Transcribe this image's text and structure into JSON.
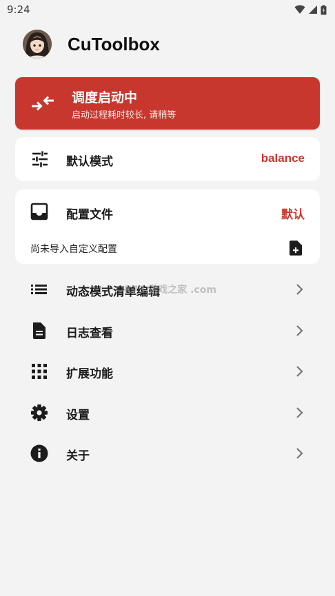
{
  "status_bar": {
    "time": "9:24"
  },
  "app": {
    "title": "CuToolbox"
  },
  "status_card": {
    "title": "调度启动中",
    "subtitle": "启动过程耗时较长, 请稍等",
    "icon": "swap-arrows-icon",
    "color": "#c8372d"
  },
  "mode_card": {
    "label": "默认模式",
    "value": "balance",
    "icon": "tune-icon"
  },
  "config_card": {
    "label": "配置文件",
    "value": "默认",
    "note": "尚未导入自定义配置",
    "icon": "inbox-icon",
    "action_icon": "add-file-icon"
  },
  "menu": [
    {
      "label": "动态模式清单编辑",
      "icon": "list-icon"
    },
    {
      "label": "日志查看",
      "icon": "document-icon"
    },
    {
      "label": "扩展功能",
      "icon": "grid-icon"
    },
    {
      "label": "设置",
      "icon": "gear-icon"
    },
    {
      "label": "关于",
      "icon": "info-icon"
    }
  ],
  "watermark": "K73 游戏之家 .com",
  "colors": {
    "accent": "#c8372d",
    "background": "#f3f3f3",
    "card": "#ffffff"
  }
}
